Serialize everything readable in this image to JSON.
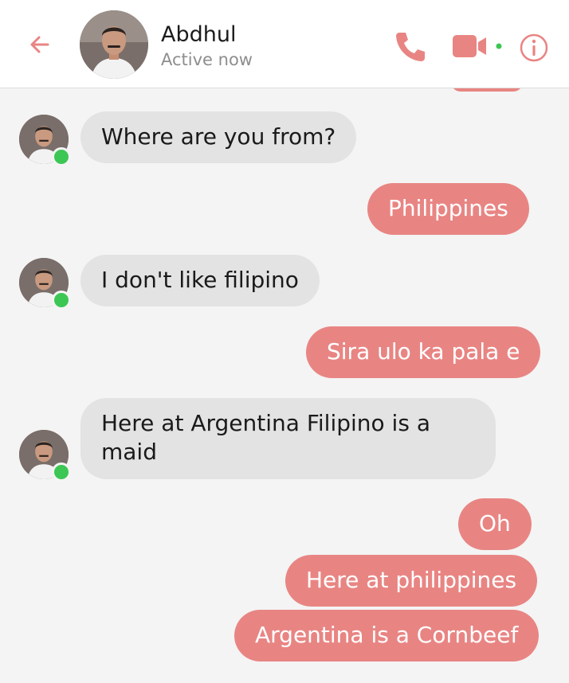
{
  "header": {
    "contact_name": "Abdhul",
    "status": "Active now"
  },
  "icons": {
    "back": "back-arrow-icon",
    "call": "phone-icon",
    "video": "video-camera-icon",
    "info": "info-icon"
  },
  "colors": {
    "accent": "#e88583",
    "incoming_bubble": "#e3e3e3",
    "online_dot": "#3cc653"
  },
  "messages": [
    {
      "direction": "incoming",
      "text": "Where are you from?"
    },
    {
      "direction": "outgoing",
      "text": "Philippines"
    },
    {
      "direction": "incoming",
      "text": "I don't like filipino"
    },
    {
      "direction": "outgoing",
      "text": "Sira ulo ka pala e"
    },
    {
      "direction": "incoming",
      "text": "Here at Argentina Filipino is a maid"
    },
    {
      "direction": "outgoing",
      "text": "Oh"
    },
    {
      "direction": "outgoing",
      "text": "Here at philippines"
    },
    {
      "direction": "outgoing",
      "text": "Argentina is a Cornbeef"
    }
  ]
}
